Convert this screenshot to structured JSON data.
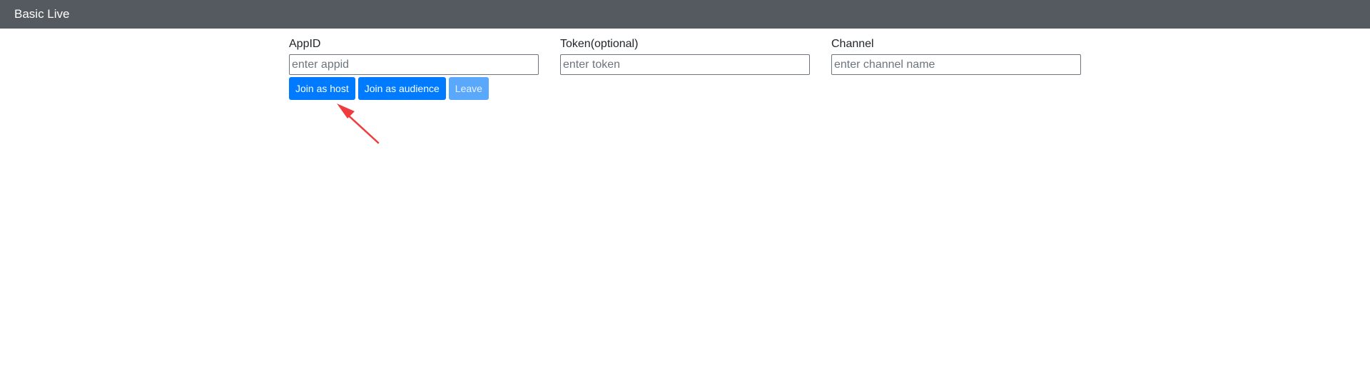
{
  "navbar": {
    "title": "Basic Live"
  },
  "form": {
    "appid": {
      "label": "AppID",
      "placeholder": "enter appid",
      "value": ""
    },
    "token": {
      "label": "Token(optional)",
      "placeholder": "enter token",
      "value": ""
    },
    "channel": {
      "label": "Channel",
      "placeholder": "enter channel name",
      "value": ""
    }
  },
  "buttons": {
    "join_host": "Join as host",
    "join_audience": "Join as audience",
    "leave": "Leave"
  },
  "colors": {
    "navbar_bg": "#545a5f",
    "primary": "#007bff",
    "disabled": "#5aa8fb",
    "annotation": "#f03c3c"
  }
}
